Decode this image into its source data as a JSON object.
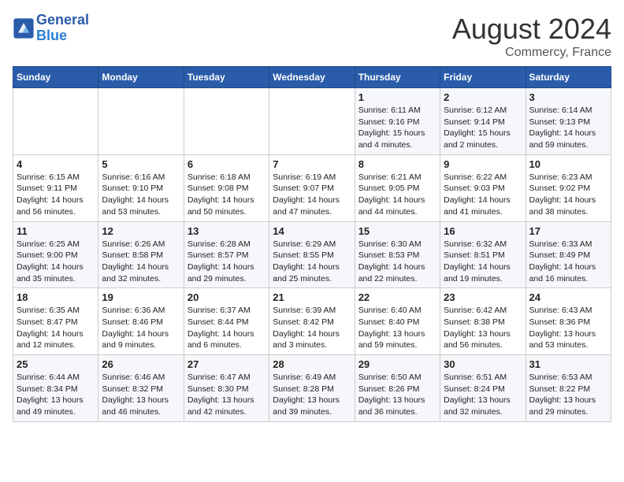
{
  "logo": {
    "line1": "General",
    "line2": "Blue"
  },
  "title": "August 2024",
  "location": "Commercy, France",
  "days_of_week": [
    "Sunday",
    "Monday",
    "Tuesday",
    "Wednesday",
    "Thursday",
    "Friday",
    "Saturday"
  ],
  "weeks": [
    [
      {
        "day": "",
        "info": ""
      },
      {
        "day": "",
        "info": ""
      },
      {
        "day": "",
        "info": ""
      },
      {
        "day": "",
        "info": ""
      },
      {
        "day": "1",
        "info": "Sunrise: 6:11 AM\nSunset: 9:16 PM\nDaylight: 15 hours\nand 4 minutes."
      },
      {
        "day": "2",
        "info": "Sunrise: 6:12 AM\nSunset: 9:14 PM\nDaylight: 15 hours\nand 2 minutes."
      },
      {
        "day": "3",
        "info": "Sunrise: 6:14 AM\nSunset: 9:13 PM\nDaylight: 14 hours\nand 59 minutes."
      }
    ],
    [
      {
        "day": "4",
        "info": "Sunrise: 6:15 AM\nSunset: 9:11 PM\nDaylight: 14 hours\nand 56 minutes."
      },
      {
        "day": "5",
        "info": "Sunrise: 6:16 AM\nSunset: 9:10 PM\nDaylight: 14 hours\nand 53 minutes."
      },
      {
        "day": "6",
        "info": "Sunrise: 6:18 AM\nSunset: 9:08 PM\nDaylight: 14 hours\nand 50 minutes."
      },
      {
        "day": "7",
        "info": "Sunrise: 6:19 AM\nSunset: 9:07 PM\nDaylight: 14 hours\nand 47 minutes."
      },
      {
        "day": "8",
        "info": "Sunrise: 6:21 AM\nSunset: 9:05 PM\nDaylight: 14 hours\nand 44 minutes."
      },
      {
        "day": "9",
        "info": "Sunrise: 6:22 AM\nSunset: 9:03 PM\nDaylight: 14 hours\nand 41 minutes."
      },
      {
        "day": "10",
        "info": "Sunrise: 6:23 AM\nSunset: 9:02 PM\nDaylight: 14 hours\nand 38 minutes."
      }
    ],
    [
      {
        "day": "11",
        "info": "Sunrise: 6:25 AM\nSunset: 9:00 PM\nDaylight: 14 hours\nand 35 minutes."
      },
      {
        "day": "12",
        "info": "Sunrise: 6:26 AM\nSunset: 8:58 PM\nDaylight: 14 hours\nand 32 minutes."
      },
      {
        "day": "13",
        "info": "Sunrise: 6:28 AM\nSunset: 8:57 PM\nDaylight: 14 hours\nand 29 minutes."
      },
      {
        "day": "14",
        "info": "Sunrise: 6:29 AM\nSunset: 8:55 PM\nDaylight: 14 hours\nand 25 minutes."
      },
      {
        "day": "15",
        "info": "Sunrise: 6:30 AM\nSunset: 8:53 PM\nDaylight: 14 hours\nand 22 minutes."
      },
      {
        "day": "16",
        "info": "Sunrise: 6:32 AM\nSunset: 8:51 PM\nDaylight: 14 hours\nand 19 minutes."
      },
      {
        "day": "17",
        "info": "Sunrise: 6:33 AM\nSunset: 8:49 PM\nDaylight: 14 hours\nand 16 minutes."
      }
    ],
    [
      {
        "day": "18",
        "info": "Sunrise: 6:35 AM\nSunset: 8:47 PM\nDaylight: 14 hours\nand 12 minutes."
      },
      {
        "day": "19",
        "info": "Sunrise: 6:36 AM\nSunset: 8:46 PM\nDaylight: 14 hours\nand 9 minutes."
      },
      {
        "day": "20",
        "info": "Sunrise: 6:37 AM\nSunset: 8:44 PM\nDaylight: 14 hours\nand 6 minutes."
      },
      {
        "day": "21",
        "info": "Sunrise: 6:39 AM\nSunset: 8:42 PM\nDaylight: 14 hours\nand 3 minutes."
      },
      {
        "day": "22",
        "info": "Sunrise: 6:40 AM\nSunset: 8:40 PM\nDaylight: 13 hours\nand 59 minutes."
      },
      {
        "day": "23",
        "info": "Sunrise: 6:42 AM\nSunset: 8:38 PM\nDaylight: 13 hours\nand 56 minutes."
      },
      {
        "day": "24",
        "info": "Sunrise: 6:43 AM\nSunset: 8:36 PM\nDaylight: 13 hours\nand 53 minutes."
      }
    ],
    [
      {
        "day": "25",
        "info": "Sunrise: 6:44 AM\nSunset: 8:34 PM\nDaylight: 13 hours\nand 49 minutes."
      },
      {
        "day": "26",
        "info": "Sunrise: 6:46 AM\nSunset: 8:32 PM\nDaylight: 13 hours\nand 46 minutes."
      },
      {
        "day": "27",
        "info": "Sunrise: 6:47 AM\nSunset: 8:30 PM\nDaylight: 13 hours\nand 42 minutes."
      },
      {
        "day": "28",
        "info": "Sunrise: 6:49 AM\nSunset: 8:28 PM\nDaylight: 13 hours\nand 39 minutes."
      },
      {
        "day": "29",
        "info": "Sunrise: 6:50 AM\nSunset: 8:26 PM\nDaylight: 13 hours\nand 36 minutes."
      },
      {
        "day": "30",
        "info": "Sunrise: 6:51 AM\nSunset: 8:24 PM\nDaylight: 13 hours\nand 32 minutes."
      },
      {
        "day": "31",
        "info": "Sunrise: 6:53 AM\nSunset: 8:22 PM\nDaylight: 13 hours\nand 29 minutes."
      }
    ]
  ]
}
